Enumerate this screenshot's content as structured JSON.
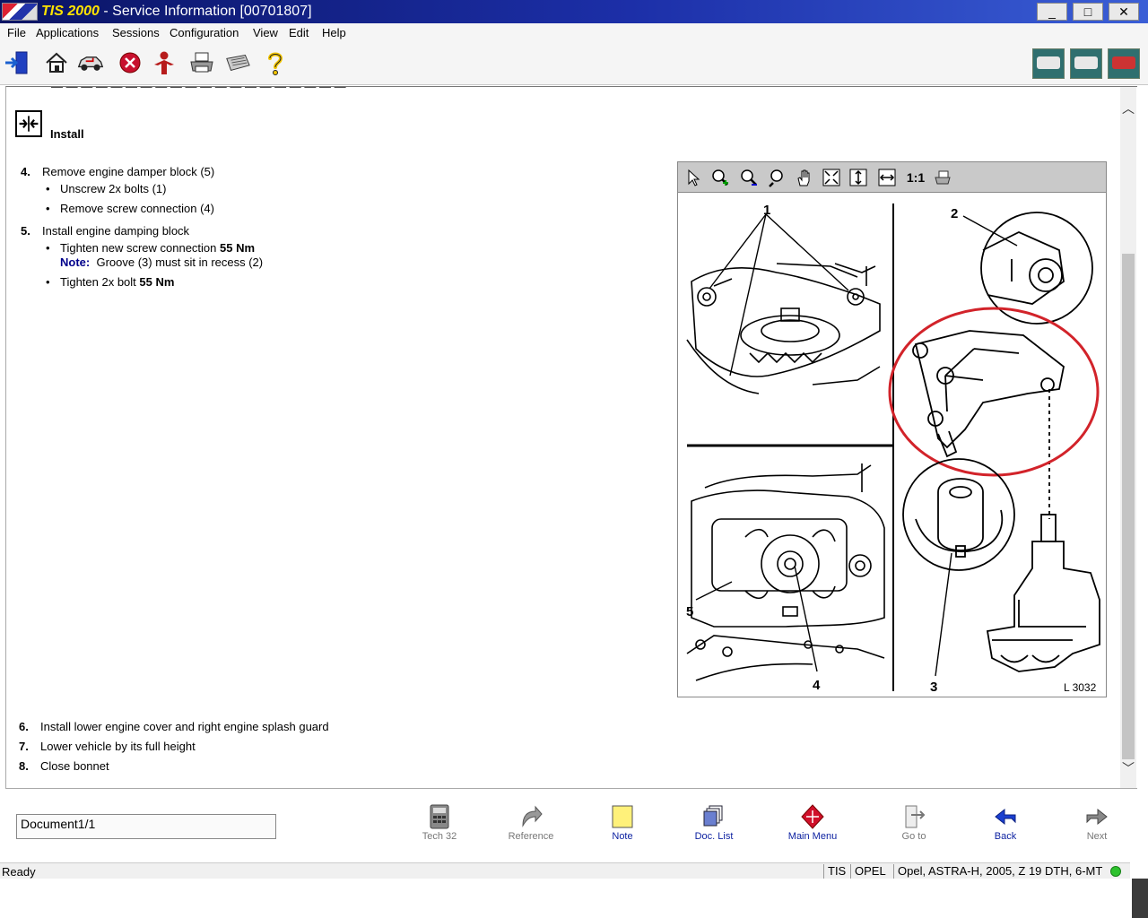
{
  "window": {
    "brand": "TIS 2000",
    "separator": " - ",
    "title": "Service Information [00701807]",
    "buttons": {
      "minimize": "_",
      "maximize": "□",
      "close": "✕"
    }
  },
  "menu": [
    "File",
    "Applications",
    "Sessions",
    "Configuration",
    "View",
    "Edit",
    "Help"
  ],
  "toolbar": {
    "icons": [
      "exit-icon",
      "home-icon",
      "vehicle-icon",
      "stop-icon",
      "person-icon",
      "print-icon",
      "keyboard-icon",
      "help-icon"
    ],
    "right_icons": [
      "vehicle-view-1-icon",
      "vehicle-view-2-icon",
      "vehicle-view-3-icon"
    ]
  },
  "document": {
    "section_title": "Install",
    "steps_top": [
      {
        "num": "4.",
        "text": "Remove engine damper block (5)",
        "bullets": [
          "Unscrew 2x bolts (1)",
          "Remove screw connection (4)"
        ]
      },
      {
        "num": "5.",
        "text": "Install engine damping block",
        "bullet1_text": "Tighten new screw connection ",
        "bullet1_bold": "55 Nm",
        "note_label": "Note:",
        "note_text": "Groove (3) must sit in recess (2)",
        "bullet2_text": "Tighten 2x bolt ",
        "bullet2_bold": "55 Nm"
      }
    ],
    "steps_bottom": [
      {
        "num": "6.",
        "text": "Install lower engine cover and right engine splash guard"
      },
      {
        "num": "7.",
        "text": "Lower vehicle by its full height"
      },
      {
        "num": "8.",
        "text": "Close bonnet"
      }
    ]
  },
  "viewer": {
    "tools": [
      "select-icon",
      "zoom-in-icon",
      "zoom-out-icon",
      "zoom-icon",
      "pan-hand-icon",
      "fit-page-icon",
      "fit-height-icon",
      "fit-width-icon"
    ],
    "ratio_label": "1:1",
    "figure": {
      "labels": [
        "1",
        "2",
        "5",
        "4",
        "3"
      ],
      "code": "L 3032"
    }
  },
  "bottom": {
    "document_field": "Document1/1",
    "nav": [
      {
        "label": "Tech 32",
        "style": "gray"
      },
      {
        "label": "Reference",
        "style": "gray"
      },
      {
        "label": "Note",
        "style": "blue"
      },
      {
        "label": "Doc. List",
        "style": "blue"
      },
      {
        "label": "Main Menu",
        "style": "blue"
      },
      {
        "label": "Go to",
        "style": "gray"
      },
      {
        "label": "Back",
        "style": "blue"
      },
      {
        "label": "Next",
        "style": "gray"
      }
    ]
  },
  "status": {
    "ready": "Ready",
    "cells": [
      "TIS",
      "OPEL",
      "Opel, ASTRA-H, 2005, Z 19 DTH, 6-MT"
    ]
  },
  "colors": {
    "titlebar": "#1c2fa8",
    "brand": "#ffe300",
    "note": "#00008b",
    "link": "#0a1fa0",
    "highlight_circle": "#d2232a"
  }
}
